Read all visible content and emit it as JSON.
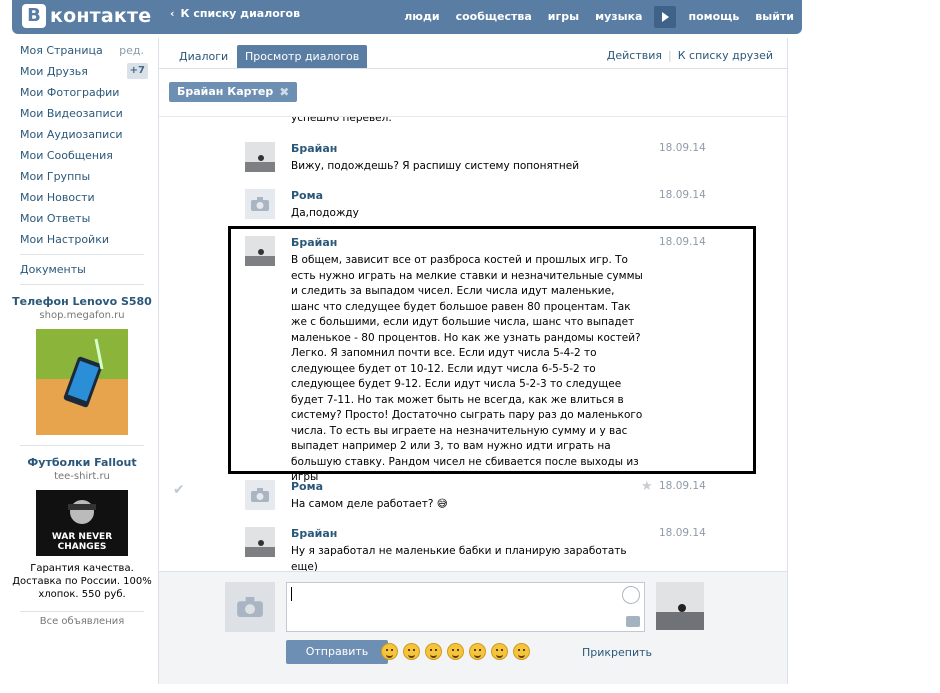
{
  "header": {
    "logo_letter": "В",
    "logo_text": "контакте",
    "back_link": "К списку диалогов",
    "nav": [
      "люди",
      "сообщества",
      "игры",
      "музыка"
    ],
    "nav2": [
      "помощь",
      "выйти"
    ]
  },
  "leftnav": {
    "items": [
      {
        "label": "Моя Страница",
        "extra": "ред."
      },
      {
        "label": "Мои Друзья",
        "badge": "+7"
      },
      {
        "label": "Мои Фотографии"
      },
      {
        "label": "Мои Видеозаписи"
      },
      {
        "label": "Мои Аудиозаписи"
      },
      {
        "label": "Мои Сообщения"
      },
      {
        "label": "Мои Группы"
      },
      {
        "label": "Мои Новости"
      },
      {
        "label": "Мои Ответы"
      },
      {
        "label": "Мои Настройки"
      }
    ],
    "documents": "Документы",
    "ads": [
      {
        "title": "Телефон Lenovo S580",
        "domain": "shop.megafon.ru"
      },
      {
        "title": "Футболки Fallout",
        "domain": "tee-shirt.ru",
        "desc": "Гарантия качества. Доставка по России. 100% хлопок. 550 руб.",
        "img_text": "WAR NEVER CHANGES"
      }
    ],
    "all_ads": "Все объявления"
  },
  "tabs": {
    "dialogs": "Диалоги",
    "view": "Просмотр диалогов",
    "actions": "Действия",
    "friends": "К списку друзей"
  },
  "chip": {
    "label": "Брайан Картер"
  },
  "messages": [
    {
      "author": "",
      "text": "успешно перевел.",
      "date": ""
    },
    {
      "author": "Брайан",
      "text": "Вижу, подождешь? Я распишу систему попонятней",
      "date": "18.09.14"
    },
    {
      "author": "Рома",
      "text": "Да,подожду",
      "date": "18.09.14"
    },
    {
      "author": "Брайан",
      "text": "В общем, зависит все от разброса костей и прошлых игр. То есть нужно играть на мелкие ставки и незначительные суммы и следить за выпадом чисел. Если числа идут маленькие, шанс что следущее будет большое равен 80 процентам. Так же с большими, если идут большие числа, шанс что выпадет маленькое - 80 процентов. Но как же узнать рандомы костей? Легко. Я запомнил почти все. Если идут числа 5-4-2 то следующее будет от 10-12. Если идут числа 6-5-5-2 то следующее будет 9-12. Если идут числа 5-2-3 то следущее будет 7-11. Но так может быть не всегда, как же влиться в систему? Просто! Достаточно сыграть пару раз до маленького числа. То есть вы играете на незначительную сумму и у вас выпадет например 2 или 3, то вам нужно идти играть на большую ставку. Рандом чисел не сбивается после выходы из игры",
      "date": "18.09.14"
    },
    {
      "author": "Рома",
      "text": "На самом деле работает? 😅",
      "date": "18.09.14"
    },
    {
      "author": "Брайан",
      "text": "Ну я заработал не маленькие бабки и планирую заработать еще)",
      "date": "18.09.14"
    }
  ],
  "composer": {
    "send": "Отправить",
    "attach": "Прикрепить"
  }
}
